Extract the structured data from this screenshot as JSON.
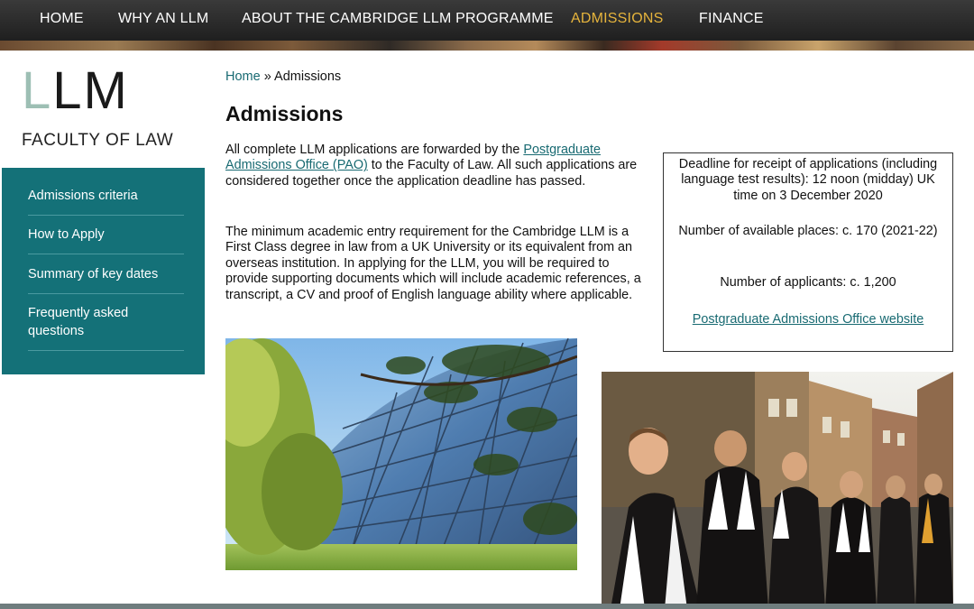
{
  "topnav": {
    "items": [
      {
        "label": "HOME"
      },
      {
        "label": "WHY AN LLM"
      },
      {
        "label": "ABOUT THE CAMBRIDGE LLM PROGRAMME"
      },
      {
        "label": "ADMISSIONS",
        "active": true
      },
      {
        "label": "FINANCE"
      }
    ],
    "active_color": "#e6b43c"
  },
  "logo": {
    "llm_first": "L",
    "llm_rest": "LM",
    "faculty": "FACULTY OF LAW"
  },
  "sidebar": {
    "background": "#147178",
    "items": [
      {
        "label": "Admissions criteria"
      },
      {
        "label": "How to Apply"
      },
      {
        "label": "Summary of key dates"
      },
      {
        "label": "Frequently asked questions"
      }
    ]
  },
  "breadcrumb": {
    "home": "Home",
    "separator": "»",
    "current": "Admissions"
  },
  "page": {
    "title": "Admissions",
    "para1_before": "All complete LLM applications are forwarded by the ",
    "para1_link": "Postgraduate Admissions Office (PAO)",
    "para1_after": " to the Faculty of Law. All such applications are considered together once the application deadline has passed.",
    "para2": "The minimum academic entry requirement for the Cambridge LLM is a First Class degree in law from a UK University or its equivalent from an overseas institution. In applying for the LLM, you will be required to provide supporting documents which will include academic references, a transcript, a CV and proof of English language ability where applicable."
  },
  "infobox": {
    "deadline": "Deadline for receipt of applications (including language test results): 12 noon (midday) UK time on 3 December 2020",
    "places": "Number of available places: c. 170 (2021-22)",
    "applicants": "Number of applicants: c. 1,200",
    "link": "Postgraduate Admissions Office website"
  },
  "images": [
    {
      "name": "glass-building-photo"
    },
    {
      "name": "graduates-procession-photo"
    }
  ]
}
